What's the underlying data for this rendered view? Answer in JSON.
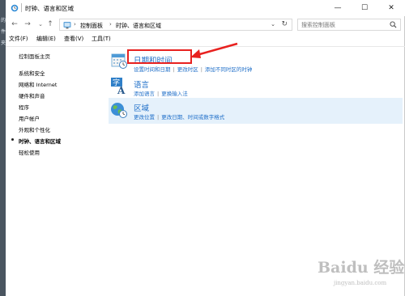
{
  "window": {
    "title": "时钟、语言和区域",
    "minimize": "—",
    "maximize": "☐",
    "close": "✕"
  },
  "nav": {
    "back": "←",
    "forward": "→",
    "up": "↑"
  },
  "address": {
    "crumbs": [
      "控制面板",
      "时钟、语言和区域"
    ],
    "separator": "›"
  },
  "search": {
    "placeholder": "搜索控制面板"
  },
  "menu": {
    "items": [
      "文件(F)",
      "编辑(E)",
      "查看(V)",
      "工具(T)"
    ]
  },
  "sidebar": {
    "items": [
      {
        "label": "控制面板主页"
      },
      {
        "label": "系统和安全"
      },
      {
        "label": "网络和 Internet"
      },
      {
        "label": "硬件和声音"
      },
      {
        "label": "程序"
      },
      {
        "label": "用户帐户"
      },
      {
        "label": "外观和个性化"
      },
      {
        "label": "时钟、语言和区域"
      },
      {
        "label": "轻松使用"
      }
    ],
    "current_index": 7
  },
  "categories": [
    {
      "title": "日期和时间",
      "icon": "calendar-clock-icon",
      "links": [
        "设置时间和日期",
        "更改时区",
        "添加不同时区的时钟"
      ]
    },
    {
      "title": "语言",
      "icon": "language-icon",
      "links": [
        "添加语言",
        "更换输入法"
      ]
    },
    {
      "title": "区域",
      "icon": "globe-clock-icon",
      "links": [
        "更改位置",
        "更改日期、时间或数字格式"
      ]
    }
  ],
  "colors": {
    "link": "#1e6ec8",
    "highlight": "#e5f1fb",
    "annotation": "#e8211f"
  },
  "watermark": {
    "text": "Baidu 经验",
    "url": "jingyan.baidu.com"
  }
}
